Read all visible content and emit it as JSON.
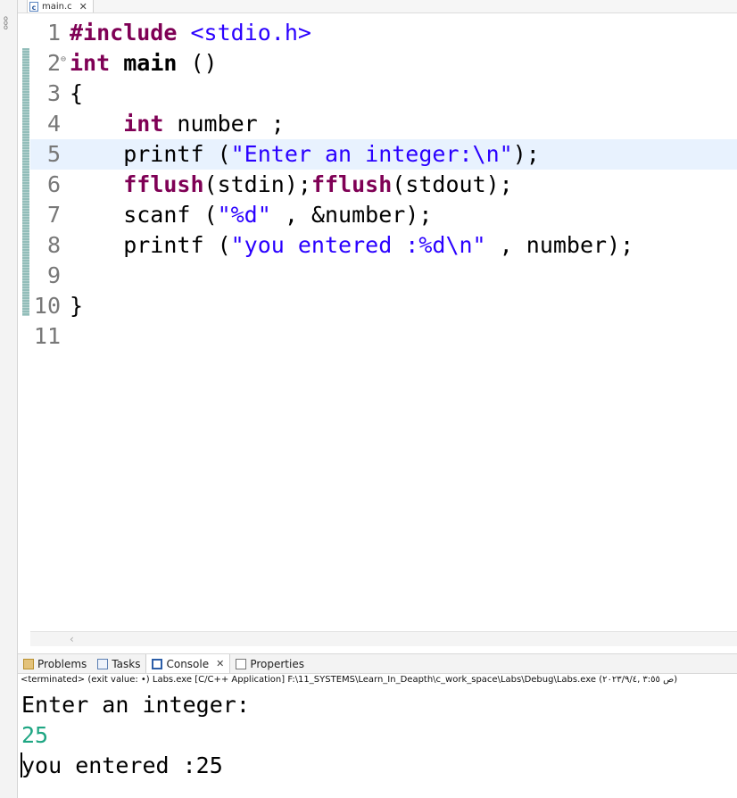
{
  "editor_tab": {
    "filename": "main.c",
    "icon": "c-file-icon"
  },
  "code": {
    "lines": [
      {
        "num": "1",
        "segments": [
          {
            "t": "kw",
            "v": "#include"
          },
          {
            "t": "plain",
            "v": " "
          },
          {
            "t": "str",
            "v": "<stdio.h>"
          }
        ]
      },
      {
        "num": "2",
        "fold": true,
        "segments": [
          {
            "t": "kw",
            "v": "int"
          },
          {
            "t": "plain",
            "v": " "
          },
          {
            "t": "bold",
            "v": "main"
          },
          {
            "t": "plain",
            "v": " ()"
          }
        ]
      },
      {
        "num": "3",
        "segments": [
          {
            "t": "plain",
            "v": "{"
          }
        ]
      },
      {
        "num": "4",
        "segments": [
          {
            "t": "plain",
            "v": "    "
          },
          {
            "t": "kw",
            "v": "int"
          },
          {
            "t": "plain",
            "v": " number ;"
          }
        ]
      },
      {
        "num": "5",
        "current": true,
        "segments": [
          {
            "t": "plain",
            "v": "    printf ("
          },
          {
            "t": "str",
            "v": "\"Enter an integer:\\n\""
          },
          {
            "t": "plain",
            "v": ");"
          }
        ]
      },
      {
        "num": "6",
        "segments": [
          {
            "t": "plain",
            "v": "    "
          },
          {
            "t": "kw",
            "v": "fflush"
          },
          {
            "t": "plain",
            "v": "(stdin);"
          },
          {
            "t": "kw",
            "v": "fflush"
          },
          {
            "t": "plain",
            "v": "(stdout);"
          }
        ]
      },
      {
        "num": "7",
        "segments": [
          {
            "t": "plain",
            "v": "    scanf ("
          },
          {
            "t": "str",
            "v": "\"%d\""
          },
          {
            "t": "plain",
            "v": " , &number);"
          }
        ]
      },
      {
        "num": "8",
        "segments": [
          {
            "t": "plain",
            "v": "    printf ("
          },
          {
            "t": "str",
            "v": "\"you entered :%d\\n\""
          },
          {
            "t": "plain",
            "v": " , number);"
          }
        ]
      },
      {
        "num": "9",
        "segments": []
      },
      {
        "num": "10",
        "segments": [
          {
            "t": "plain",
            "v": "}"
          }
        ]
      },
      {
        "num": "11",
        "segments": []
      }
    ]
  },
  "panel": {
    "tabs": [
      {
        "label": "Problems",
        "icon": "problems-icon",
        "active": false
      },
      {
        "label": "Tasks",
        "icon": "tasks-icon",
        "active": false
      },
      {
        "label": "Console",
        "icon": "console-icon",
        "active": true,
        "closable": true
      },
      {
        "label": "Properties",
        "icon": "properties-icon",
        "active": false
      }
    ],
    "status": "<terminated> (exit value: •) Labs.exe [C/C++ Application] F:\\11_SYSTEMS\\Learn_In_Deapth\\c_work_space\\Labs\\Debug\\Labs.exe (ص ٣:٥٥ ,٢٠٢٣/٩/٤)",
    "output": [
      {
        "text": "Enter an integer:",
        "kind": "output"
      },
      {
        "text": "25",
        "kind": "input"
      },
      {
        "text": "you entered :25",
        "kind": "output"
      }
    ]
  },
  "colors": {
    "keyword": "#7f0055",
    "string": "#2a00ff",
    "input_text": "#1fa683",
    "current_line": "#e8f2fe",
    "line_number": "#787878"
  }
}
